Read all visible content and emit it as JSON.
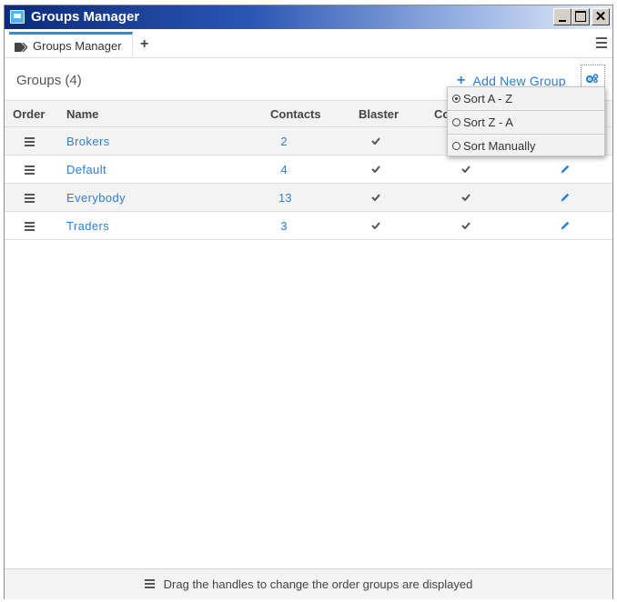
{
  "window": {
    "title": "Groups Manager"
  },
  "tabs": {
    "active_label": "Groups Manager",
    "add_label": "+"
  },
  "header": {
    "title": "Groups (4)",
    "add_group_label": "Add New Group"
  },
  "table": {
    "columns": {
      "order": "Order",
      "name": "Name",
      "contacts": "Contacts",
      "blaster": "Blaster",
      "c": "Co"
    },
    "rows": [
      {
        "name": "Brokers",
        "contacts": "2",
        "blaster": true,
        "c": true,
        "editable": true
      },
      {
        "name": "Default",
        "contacts": "4",
        "blaster": true,
        "c": true,
        "editable": true
      },
      {
        "name": "Everybody",
        "contacts": "13",
        "blaster": true,
        "c": true,
        "editable": true
      },
      {
        "name": "Traders",
        "contacts": "3",
        "blaster": true,
        "c": true,
        "editable": true
      }
    ]
  },
  "sort_menu": {
    "items": [
      {
        "label": "Sort A - Z",
        "selected": true
      },
      {
        "label": "Sort Z - A",
        "selected": false
      },
      {
        "label": "Sort Manually",
        "selected": false
      }
    ]
  },
  "footer": {
    "hint": "Drag the handles to change the order groups are displayed"
  },
  "colors": {
    "accent": "#2a7fdc",
    "title_bar_dark": "#0b2a7a",
    "tab_accent": "#2a8fe0"
  },
  "icons": {
    "app": "app-icon",
    "tag": "tag-icon",
    "menu": "hamburger-icon",
    "gear": "gears-icon",
    "check": "check-icon",
    "edit": "pencil-icon",
    "handle": "drag-handle-icon"
  }
}
